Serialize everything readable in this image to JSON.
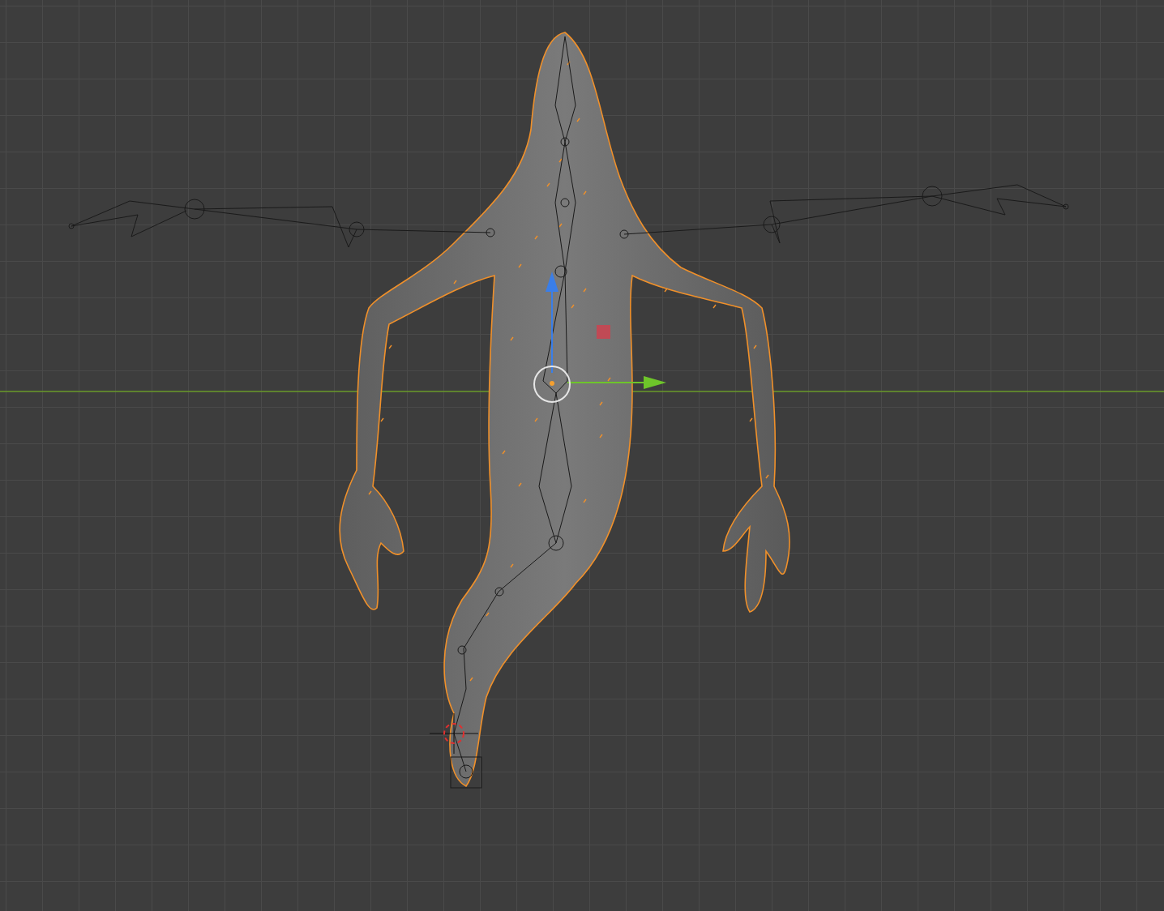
{
  "viewport": {
    "object": {
      "selected": true
    }
  }
}
